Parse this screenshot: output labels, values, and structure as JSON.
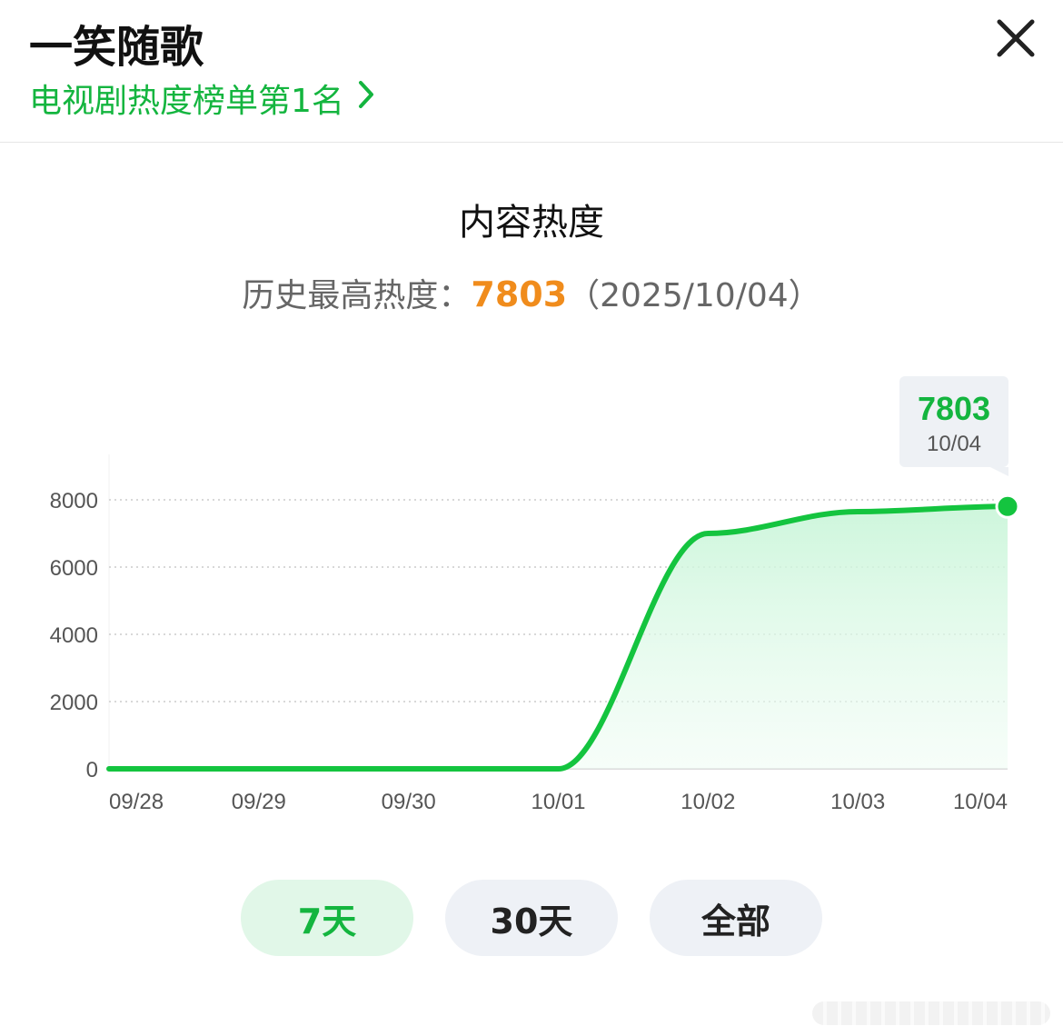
{
  "header": {
    "title": "一笑随歌",
    "rank_link": "电视剧热度榜单第1名"
  },
  "heat": {
    "title": "内容热度",
    "record_label": "历史最高热度：",
    "record_value": "7803",
    "record_date": "（2025/10/04）"
  },
  "chart_data": {
    "type": "area",
    "categories": [
      "09/28",
      "09/29",
      "09/30",
      "10/01",
      "10/02",
      "10/03",
      "10/04"
    ],
    "values": [
      0,
      0,
      0,
      0,
      7000,
      7650,
      7803
    ],
    "ylim": [
      0,
      8000
    ],
    "yticks": [
      0,
      2000,
      4000,
      6000,
      8000
    ],
    "grid": true,
    "line_color": "#14c43f",
    "fill_color": "#d6f8e2",
    "tooltip": {
      "value": "7803",
      "date": "10/04"
    }
  },
  "range_tabs": [
    {
      "label": "7天",
      "active": true
    },
    {
      "label": "30天",
      "active": false
    },
    {
      "label": "全部",
      "active": false
    }
  ],
  "colors": {
    "accent": "#14b53f",
    "highlight": "#f08c1c"
  }
}
